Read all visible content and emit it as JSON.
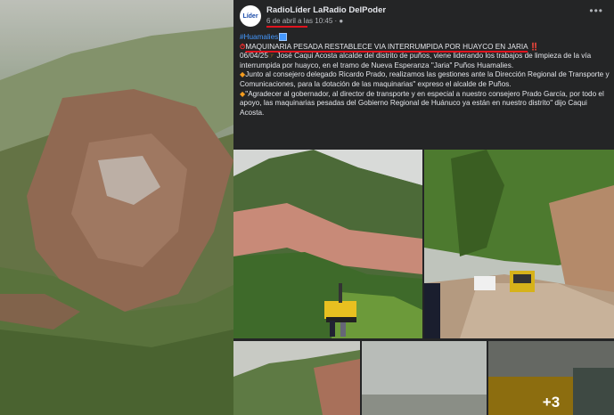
{
  "post": {
    "page_name": "RadioLíder LaRadio DelPoder",
    "meta": "6 de abril a las 10:45 · ",
    "avatar_text": "Líder",
    "more_icon": "more-icon",
    "hashtag": "#Huamalies",
    "headline": "MAQUINARIA PESADA RESTABLECE VIA INTERRUMPIDA POR HUAYCO EN JARIA",
    "headline_bang": "‼️",
    "para1_date": "06/04/25",
    "para1_text": " José Caqui Acosta alcalde del distrito de puños, viene liderando los trabajos de limpieza de la vía interrumpida por huayco, en el tramo de Nueva Esperanza \"Jaria\" Puños Huamalies.",
    "para2_text": "Junto al consejero delegado Ricardo Prado, realizamos  las gestiones ante la Dirección Regional de Transporte y Comunicaciones, para la dotación de las maquinarias\" expreso el alcalde de Puños.",
    "para3_text": "\"Agradecer al gobernador, al director de transporte y en especial a nuestro consejero Prado García, por todo el apoyo, las maquinarias pesadas del Gobierno Regional de Huánuco ya están en nuestro distrito\" dijo Caqui Acosta.",
    "more_photos": "+3"
  },
  "colors": {
    "background": "#242526",
    "text": "#e4e6eb",
    "secondary": "#b0b3b8",
    "link": "#4599ff",
    "annotation_red": "#e0141f",
    "bullet_orange": "#f39c1f"
  }
}
